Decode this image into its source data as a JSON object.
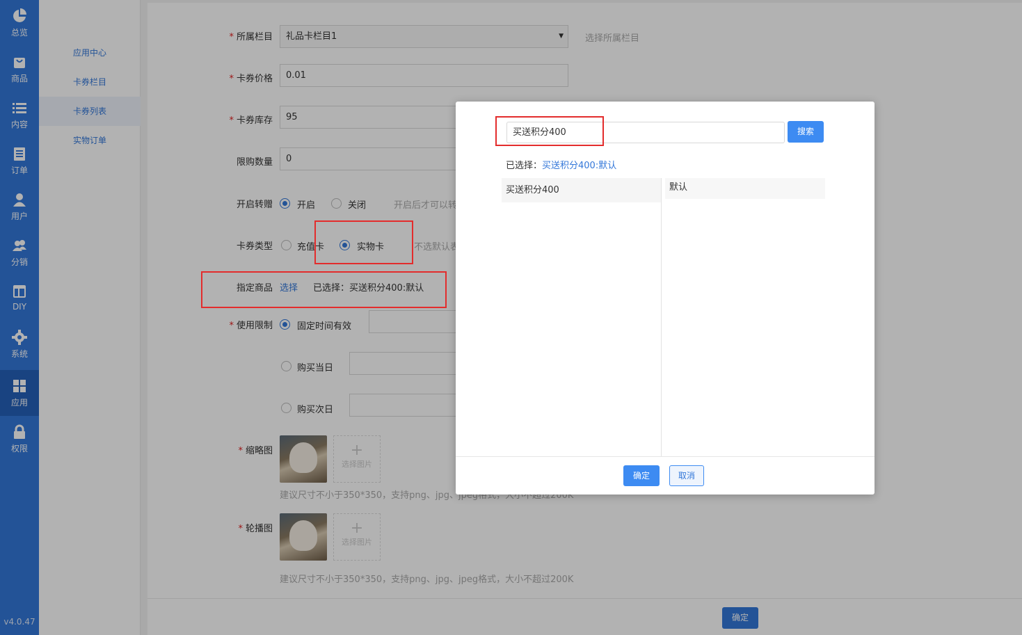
{
  "sidebar": {
    "items": [
      {
        "label": "总览",
        "icon": "pie-chart-icon"
      },
      {
        "label": "商品",
        "icon": "shopping-bag-icon"
      },
      {
        "label": "内容",
        "icon": "list-icon"
      },
      {
        "label": "订单",
        "icon": "document-icon"
      },
      {
        "label": "用户",
        "icon": "user-icon"
      },
      {
        "label": "分销",
        "icon": "users-icon"
      },
      {
        "label": "DIY",
        "icon": "layout-icon"
      },
      {
        "label": "系统",
        "icon": "gear-icon"
      },
      {
        "label": "应用",
        "icon": "grid-icon"
      },
      {
        "label": "权限",
        "icon": "lock-icon"
      }
    ],
    "active_index": 8,
    "version": "v4.0.47"
  },
  "submenu": {
    "items": [
      "应用中心",
      "卡券栏目",
      "卡券列表",
      "实物订单"
    ],
    "active": "卡券列表"
  },
  "form": {
    "category": {
      "label": "所属栏目",
      "value": "礼品卡栏目1",
      "hint": "选择所属栏目"
    },
    "price": {
      "label": "卡券价格",
      "value": "0.01"
    },
    "stock": {
      "label": "卡券库存",
      "value": "95"
    },
    "limit": {
      "label": "限购数量",
      "value": "0"
    },
    "transfer": {
      "label": "开启转赠",
      "on": "开启",
      "off": "关闭",
      "hint": "开启后才可以转"
    },
    "card_type": {
      "label": "卡券类型",
      "recharge": "充值卡",
      "physical": "实物卡",
      "hint": "不选默认表"
    },
    "product": {
      "label": "指定商品",
      "link": "选择",
      "selected": "已选择：买送积分400:默认"
    },
    "usage": {
      "label": "使用限制",
      "opt1": "固定时间有效",
      "opt2": "购买当日",
      "opt3": "购买次日"
    },
    "thumbnail": {
      "label": "缩略图",
      "add_text": "选择图片",
      "hint": "建议尺寸不小于350*350，支持png、jpg、jpeg格式，大小不超过200K"
    },
    "carousel": {
      "label": "轮播图",
      "add_text": "选择图片",
      "hint": "建议尺寸不小于350*350，支持png、jpg、jpeg格式，大小不超过200K"
    },
    "submit": "确定"
  },
  "modal": {
    "search_value": "买送积分400",
    "search_button": "搜索",
    "selected_prefix": "已选择：",
    "selected_value": "买送积分400:默认",
    "left_items": [
      "买送积分400"
    ],
    "right_items": [
      "默认"
    ],
    "ok": "确定",
    "cancel": "取消"
  },
  "colors": {
    "primary": "#3377d9",
    "highlight": "#e32c2c"
  }
}
